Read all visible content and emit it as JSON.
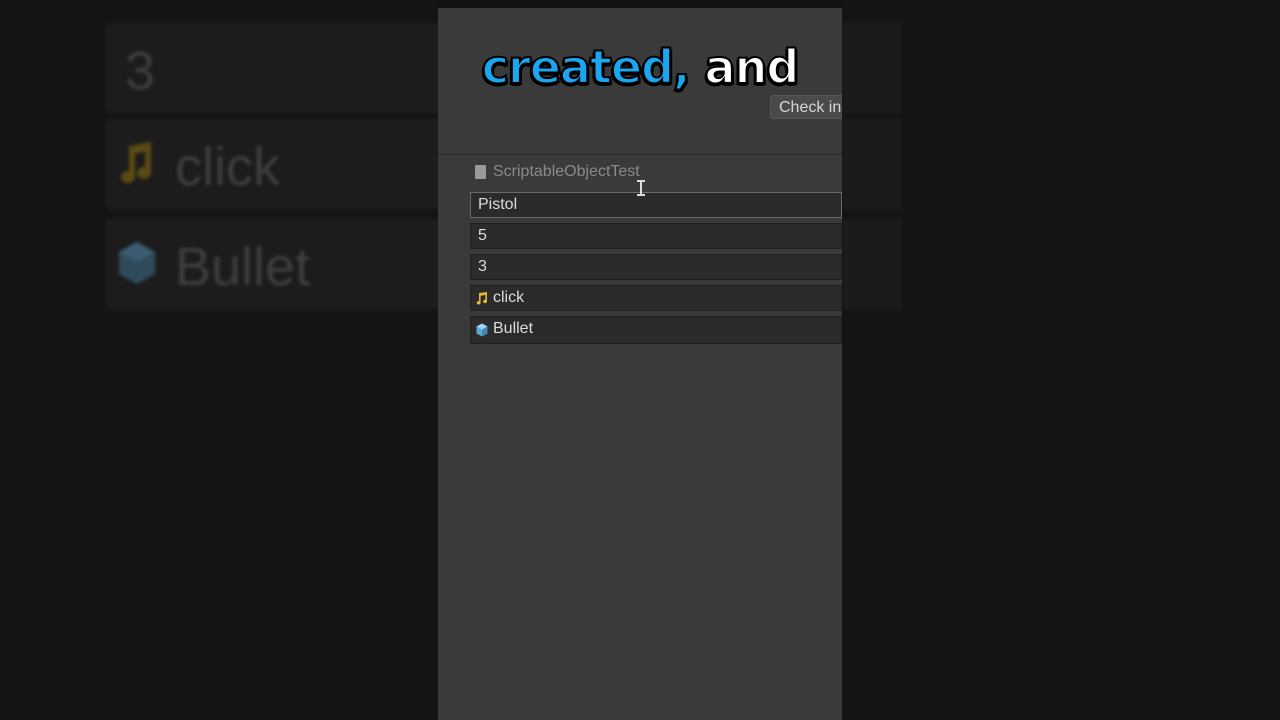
{
  "caption": {
    "highlight": "created,",
    "rest": "and"
  },
  "toolbar": {
    "check_label": "Check in"
  },
  "script": {
    "name": "ScriptableObjectTest",
    "icon": "script-file-icon"
  },
  "fields": {
    "name_value": "Pistol",
    "int_value_1": "5",
    "int_value_2": "3",
    "audio_clip": {
      "label": "click",
      "icon": "audio-clip-icon"
    },
    "prefab": {
      "label": "Bullet",
      "icon": "prefab-cube-icon"
    }
  },
  "background": {
    "row1_text": "3",
    "row2_text": "click",
    "row3_text": "Bullet"
  },
  "colors": {
    "caption_highlight": "#1aa6f0",
    "panel_bg": "#3a3a3a",
    "field_bg": "#2b2b2b"
  }
}
